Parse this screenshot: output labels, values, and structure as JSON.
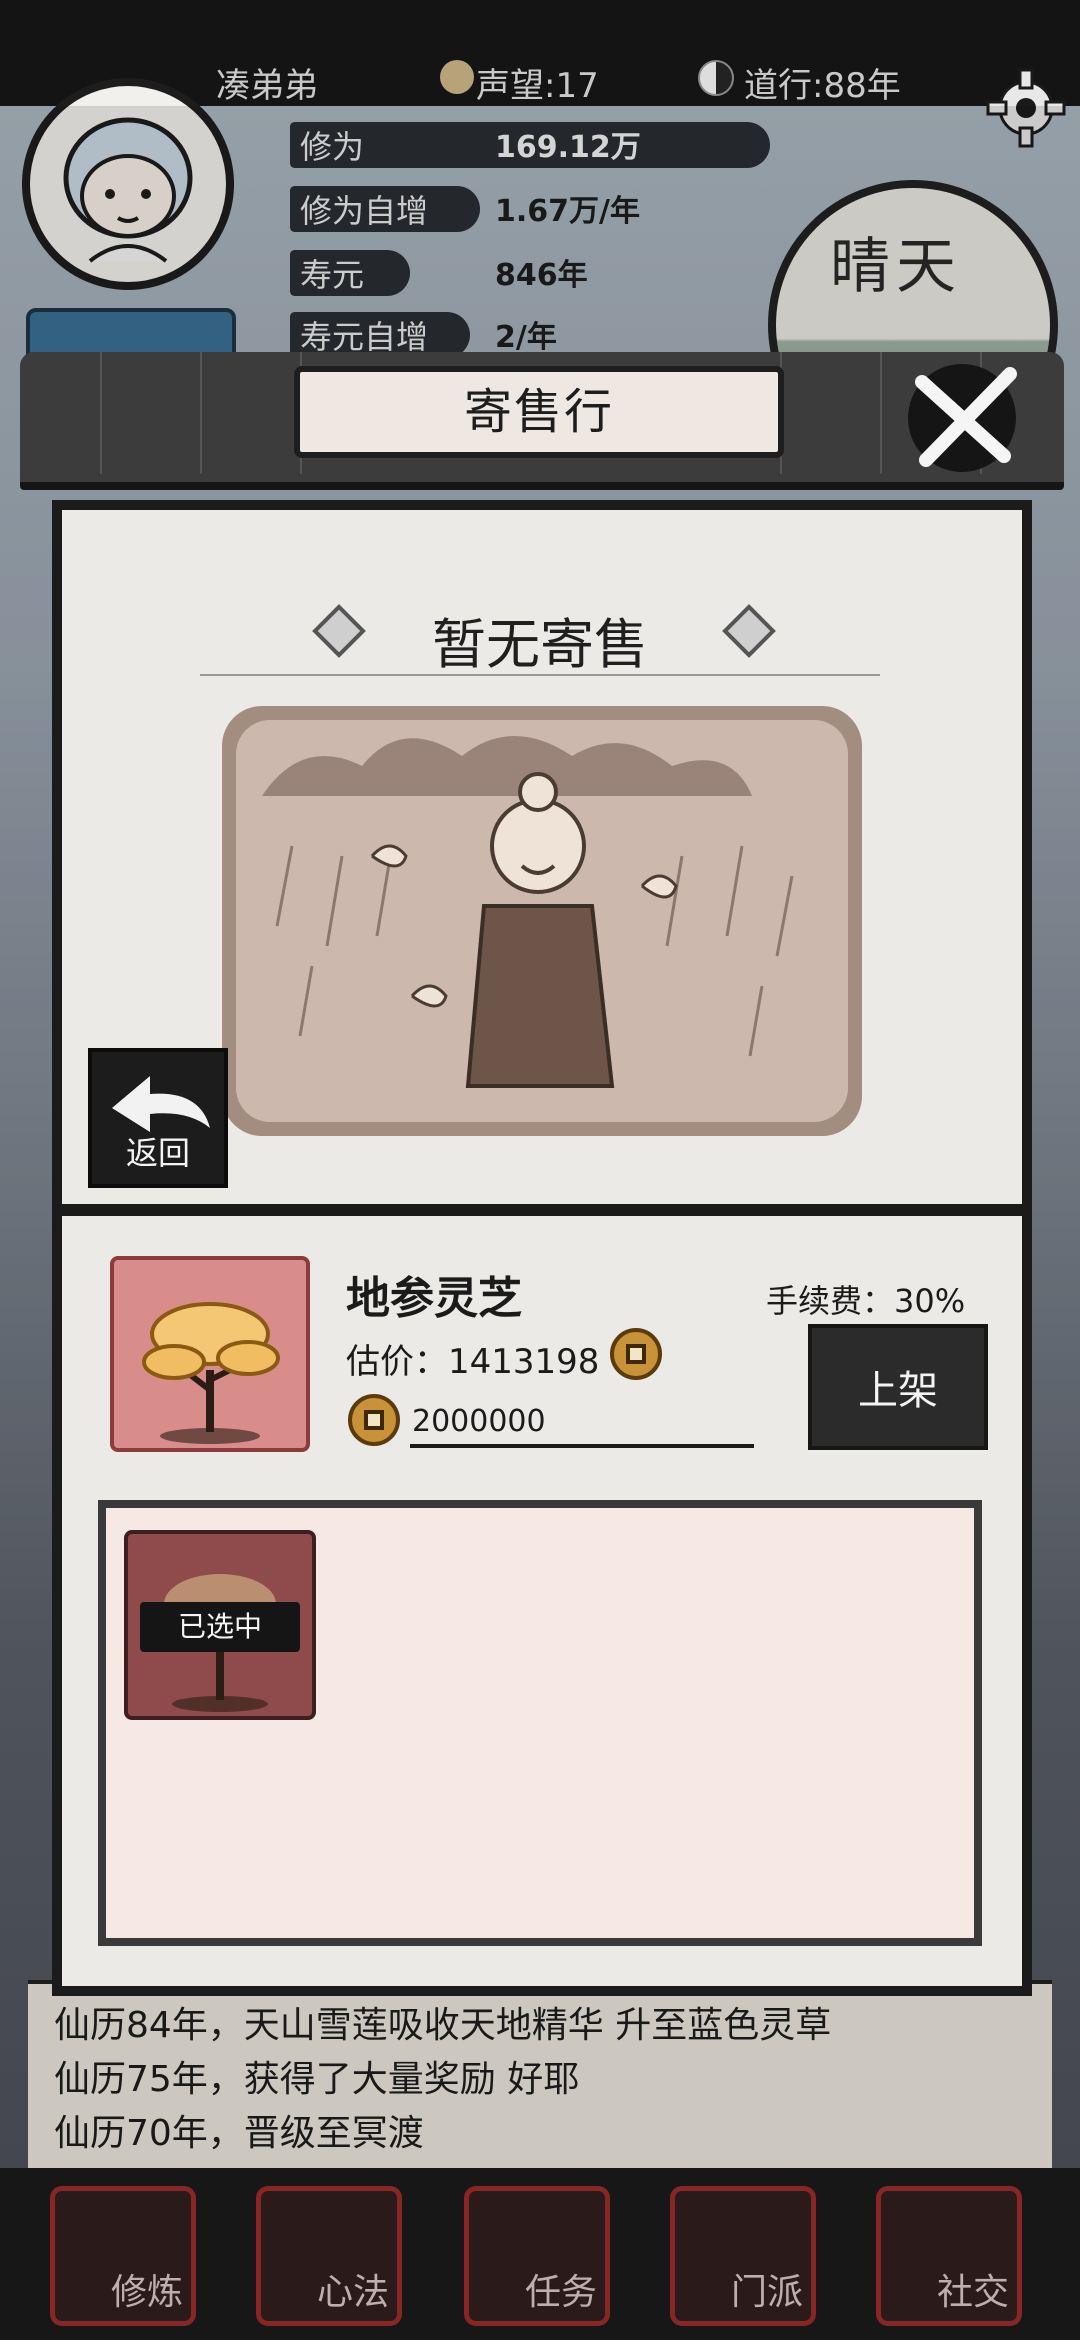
{
  "hud": {
    "player_name": "凑弟弟",
    "reputation": "声望:17",
    "dao_years": "道行:88年",
    "stats": [
      {
        "label": "修为",
        "value": "169.12万"
      },
      {
        "label": "修为自增",
        "value": "1.67万/年"
      },
      {
        "label": "寿元",
        "value": "846年"
      },
      {
        "label": "寿元自增",
        "value": "2/年"
      }
    ],
    "weather": "晴天",
    "icons": {
      "reputation": "medal-icon",
      "dao": "yin-yang-icon",
      "settings": "gear-icon"
    }
  },
  "modal": {
    "title": "寄售行",
    "empty_text": "暂无寄售",
    "back_label": "返回",
    "item": {
      "name": "地参灵芝",
      "appraisal": "估价：1413198",
      "price_value": "2000000",
      "fee": "手续费：30%",
      "list_label": "上架"
    },
    "inventory": {
      "selected_tag": "已选中"
    }
  },
  "log": {
    "lines": [
      "仙历84年，天山雪莲吸收天地精华 升至蓝色灵草",
      "仙历75年，获得了大量奖励 好耶",
      "仙历70年，晋级至冥渡"
    ]
  },
  "nav": [
    {
      "label": "修炼"
    },
    {
      "label": "心法"
    },
    {
      "label": "任务"
    },
    {
      "label": "门派"
    },
    {
      "label": "社交"
    }
  ],
  "colors": {
    "nav_accent": "#9b2b2b",
    "coin": "#c79238",
    "item_bg": "#d98d8a"
  }
}
